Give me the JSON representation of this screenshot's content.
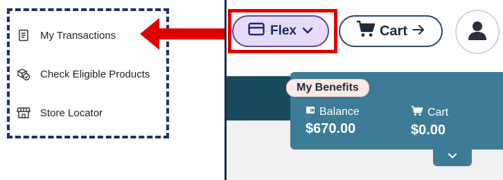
{
  "menu": {
    "items": [
      {
        "label": "My Transactions",
        "icon": "receipt-icon"
      },
      {
        "label": "Check Eligible Products",
        "icon": "products-check-icon"
      },
      {
        "label": "Store Locator",
        "icon": "store-icon"
      }
    ]
  },
  "header": {
    "flex_label": "Flex",
    "cart_label": "Cart"
  },
  "benefits": {
    "tab_label": "My Benefits",
    "balance_label": "Balance",
    "balance_value": "$670.00",
    "cart_label": "Cart",
    "cart_value": "$0.00"
  },
  "colors": {
    "menu_border": "#1e3060",
    "highlight_red": "#e00000",
    "flex_pill_bg": "#e8daf9",
    "banner_dark": "#1a4a5e",
    "card_teal": "#3d7c97"
  }
}
